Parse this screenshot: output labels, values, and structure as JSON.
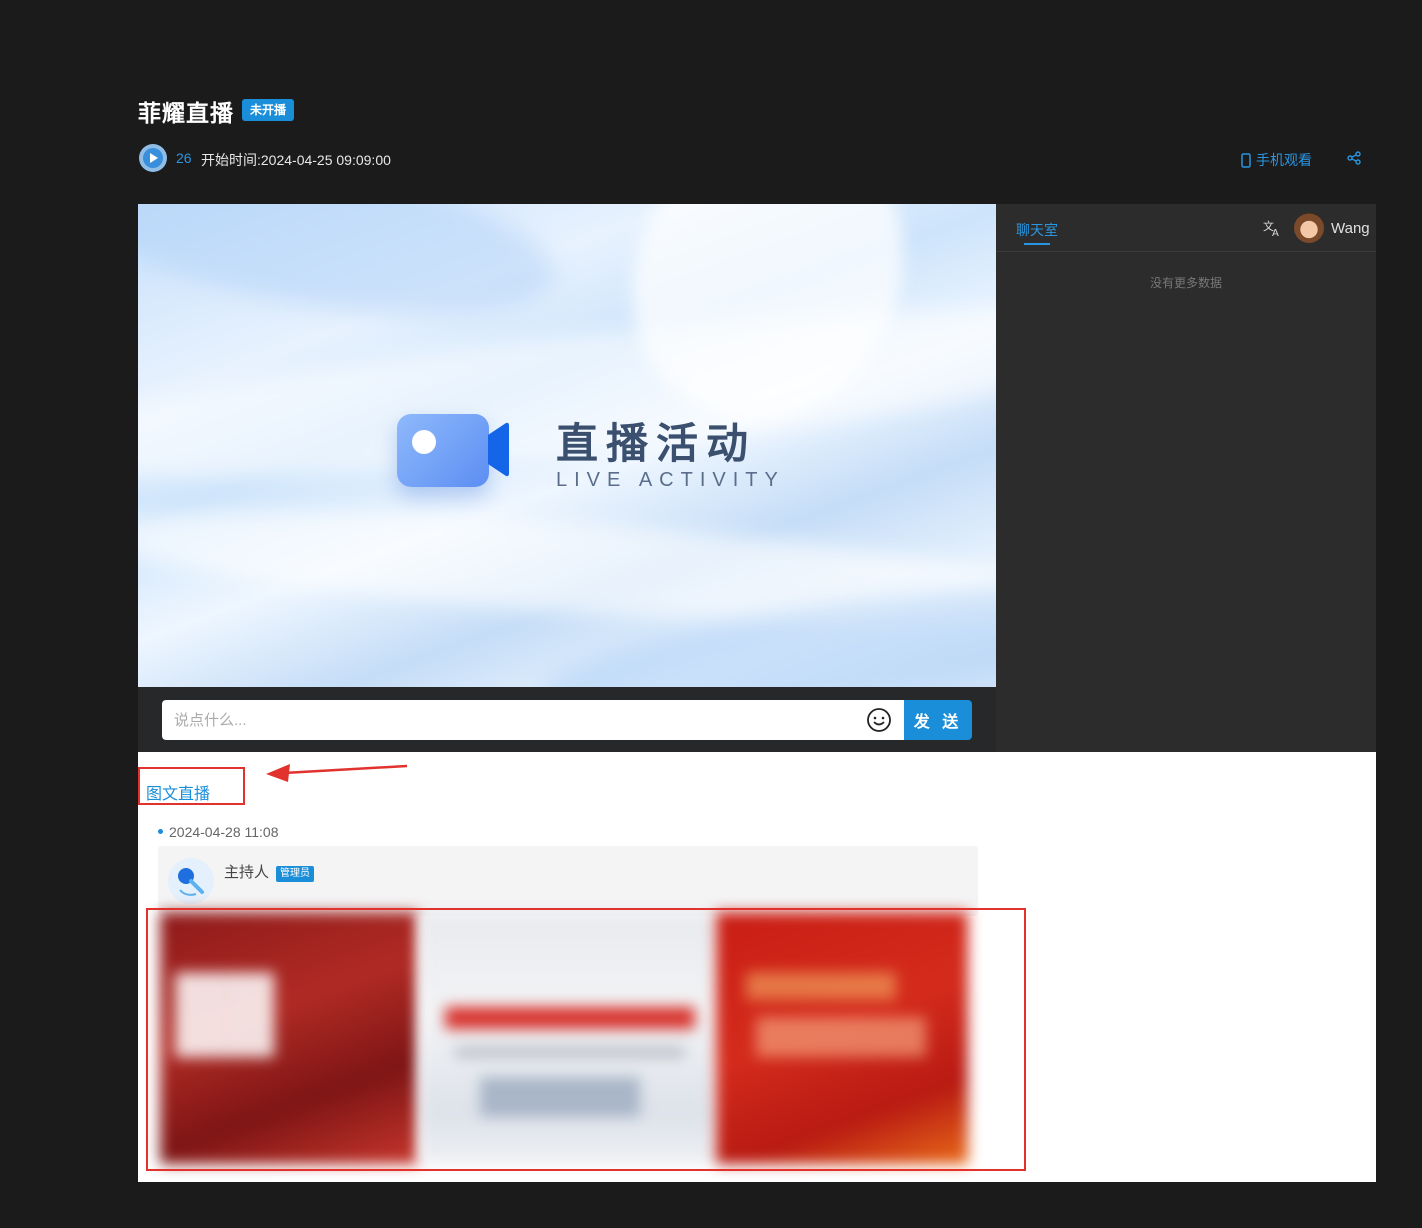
{
  "header": {
    "title": "菲耀直播",
    "status": "未开播",
    "view_count": "26",
    "start_time": "开始时间:2024-04-25 09:09:00",
    "mobile_view_label": "手机观看"
  },
  "player": {
    "title_cn": "直播活动",
    "title_en": "LIVE ACTIVITY"
  },
  "comment": {
    "placeholder": "说点什么...",
    "send_label": "发 送"
  },
  "chat": {
    "tab_label": "聊天室",
    "user_name": "Wang",
    "empty_text": "没有更多数据"
  },
  "graphic_live": {
    "section_title": "图文直播",
    "post": {
      "time": "2024-04-28 11:08",
      "author": "主持人",
      "role_badge": "管理员"
    }
  },
  "colors": {
    "accent": "#1a8ed8",
    "annotation": "#e1322e",
    "background": "#1b1b1c"
  }
}
